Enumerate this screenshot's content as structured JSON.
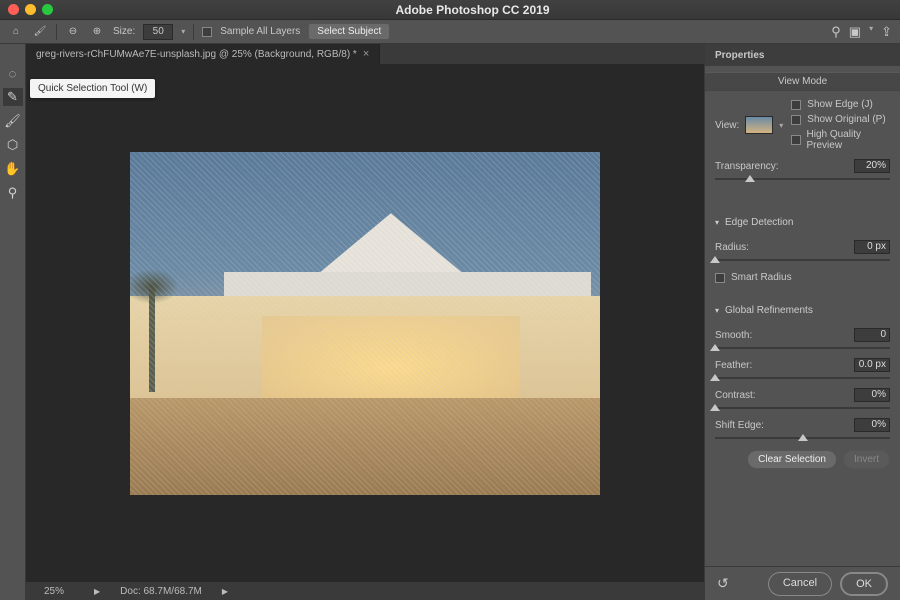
{
  "titlebar": {
    "title": "Adobe Photoshop CC 2019"
  },
  "optbar": {
    "size_label": "Size:",
    "size_value": "50",
    "sample_all": "Sample All Layers",
    "select_subject": "Select Subject"
  },
  "tooltip": "Quick Selection Tool (W)",
  "document": {
    "tab": "greg-rivers-rChFUMwAe7E-unsplash.jpg @ 25% (Background, RGB/8) *"
  },
  "status": {
    "zoom": "25%",
    "doc": "Doc: 68.7M/68.7M"
  },
  "panel": {
    "title": "Properties",
    "view_mode": {
      "header": "View Mode",
      "view_label": "View:",
      "show_edge": "Show Edge (J)",
      "show_original": "Show Original (P)",
      "hq_preview": "High Quality Preview"
    },
    "transparency": {
      "label": "Transparency:",
      "value": "20%"
    },
    "edge": {
      "header": "Edge Detection",
      "radius_label": "Radius:",
      "radius_value": "0 px",
      "smart_radius": "Smart Radius"
    },
    "refine": {
      "header": "Global Refinements",
      "smooth_label": "Smooth:",
      "smooth_value": "0",
      "feather_label": "Feather:",
      "feather_value": "0.0 px",
      "contrast_label": "Contrast:",
      "contrast_value": "0%",
      "shift_label": "Shift Edge:",
      "shift_value": "0%"
    },
    "clear_selection": "Clear Selection",
    "invert": "Invert",
    "cancel": "Cancel",
    "ok": "OK"
  }
}
